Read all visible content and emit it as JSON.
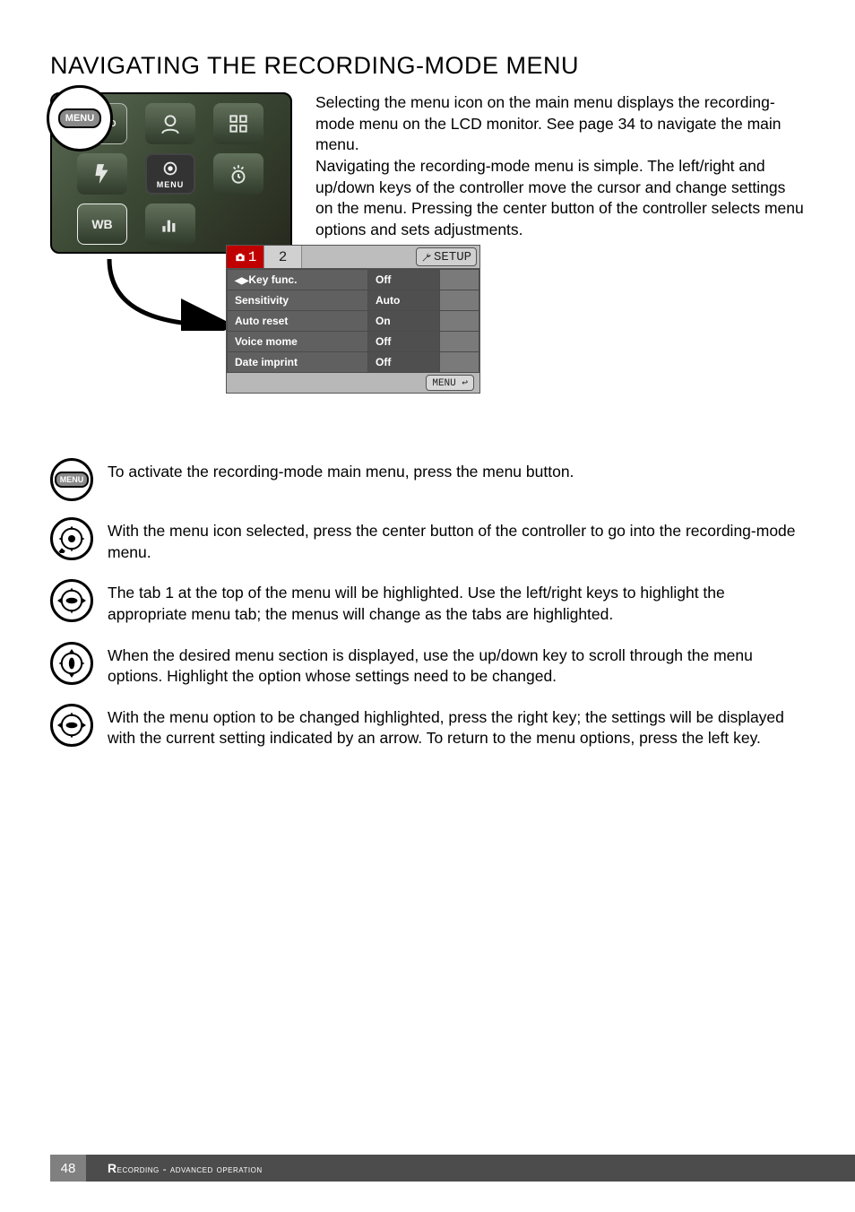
{
  "title": "NAVIGATING THE RECORDING-MODE MENU",
  "intro": {
    "para1": "Selecting the menu icon on the main menu displays the recording-mode menu on the LCD monitor. See page 34 to navigate the main menu.",
    "para2": "Navigating the recording-mode menu is simple. The left/right and up/down keys of the controller move the cursor and change settings on the menu. Pressing the center button of the controller selects menu options and sets adjustments."
  },
  "callout_label": "MENU",
  "lcd1": {
    "iconMenuLabel": "MENU",
    "iconMono": "MONO",
    "iconFace": "face-icon",
    "iconGrid": "grid-icon",
    "iconFlash": "flash-icon",
    "iconTarget": "focus-center-icon",
    "iconSelfTimer": "self-timer-icon",
    "iconWB": "WB",
    "iconHistogram": "histogram-icon"
  },
  "menu_lcd": {
    "tab1": "1",
    "tab2": "2",
    "setup": "SETUP",
    "rows": [
      {
        "label": "Key func.",
        "value": "Off"
      },
      {
        "label": "Sensitivity",
        "value": "Auto"
      },
      {
        "label": "Auto reset",
        "value": "On"
      },
      {
        "label": "Voice mome",
        "value": "Off"
      },
      {
        "label": "Date imprint",
        "value": "Off"
      }
    ],
    "footer": "MENU"
  },
  "steps": {
    "s1": "To activate the recording-mode main menu, press the menu button.",
    "s2": "With the menu icon selected, press the center button of the controller to go into the recording-mode menu.",
    "s3": "The tab 1 at the top of the menu will be highlighted. Use the left/right keys to highlight the appropriate menu tab; the menus will change as the tabs are highlighted.",
    "s4": "When the desired menu section is displayed, use the up/down key to scroll through the menu options. Highlight the option whose settings need to be changed.",
    "s5": "With the menu option to be changed highlighted, press the right key; the settings will be displayed with the current setting indicated by an arrow. To return to the menu options, press the left key."
  },
  "footer": {
    "page": "48",
    "section_prefix": "R",
    "section_rest": "ecording - advanced operation"
  }
}
